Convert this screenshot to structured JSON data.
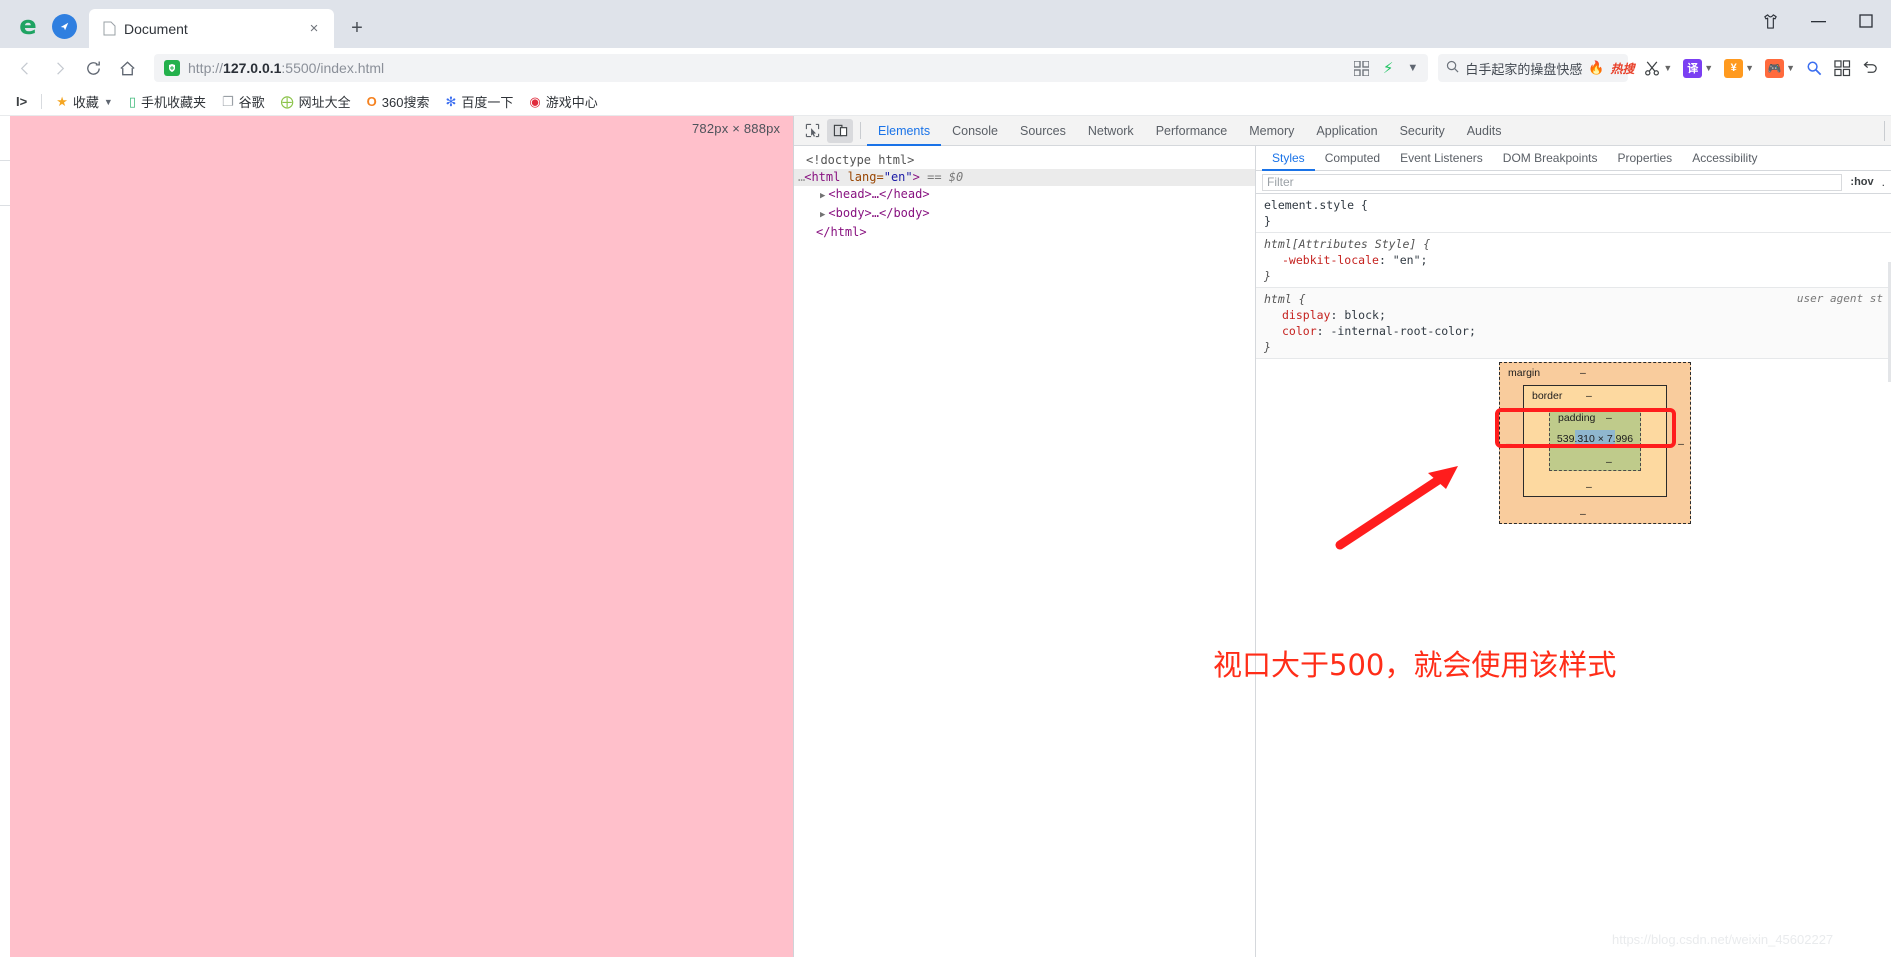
{
  "window": {
    "controls": [
      {
        "name": "theme-tshirt",
        "glyph": "👕"
      },
      {
        "name": "minimize",
        "glyph": "—"
      },
      {
        "name": "maximize",
        "glyph": "☐"
      }
    ]
  },
  "tabs": {
    "active_title": "Document",
    "close_label": "×",
    "newtab_label": "+"
  },
  "nav": {
    "back": "‹",
    "forward": "›",
    "reload": "⟳",
    "home": "⌂",
    "url_prefix": "http://",
    "url_host": "127.0.0.1",
    "url_rest": ":5500/index.html"
  },
  "search": {
    "value": "白手起家的操盘快感",
    "hot_label": "热搜"
  },
  "bookmarks": [
    {
      "label": "收藏",
      "icon": "star-icon",
      "glyph": "★",
      "color": "#f5a623",
      "caret": "▾"
    },
    {
      "label": "手机收藏夹",
      "icon": "phone-icon",
      "glyph": "▭",
      "color": "#3cb878"
    },
    {
      "label": "谷歌",
      "icon": "page-icon",
      "glyph": "❐",
      "color": "#9aa0a6"
    },
    {
      "label": "网址大全",
      "icon": "globe-plus-icon",
      "glyph": "⊕",
      "color": "#8bc34a"
    },
    {
      "label": "360搜索",
      "icon": "circle-o-icon",
      "glyph": "O",
      "color": "#f58220"
    },
    {
      "label": "百度一下",
      "icon": "paw-icon",
      "glyph": "✻",
      "color": "#3b6ef0"
    },
    {
      "label": "游戏中心",
      "icon": "g-circle-icon",
      "glyph": "G",
      "color": "#e02b3c"
    }
  ],
  "viewport": {
    "dimension_badge": "782px × 888px",
    "background": "#ffc0cb"
  },
  "devtools": {
    "panel_tabs": [
      "Elements",
      "Console",
      "Sources",
      "Network",
      "Performance",
      "Memory",
      "Application",
      "Security",
      "Audits"
    ],
    "active_panel": "Elements",
    "inspect_icon": "inspect-element-icon",
    "device_icon": "device-toolbar-icon",
    "dom": {
      "line1": "<!doctype html>",
      "line2_dots": "…",
      "line2_tag_open": "<html",
      "line2_attr": " lang=",
      "line2_attr_value": "\"en\"",
      "line2_tag_close": ">",
      "line2_selected": "== $0",
      "line3": "<head>…</head>",
      "line4": "<body>…</body>",
      "line5": "</html>"
    },
    "styles": {
      "tabs": [
        "Styles",
        "Computed",
        "Event Listeners",
        "DOM Breakpoints",
        "Properties",
        "Accessibility"
      ],
      "active_tab": "Styles",
      "filter_placeholder": "Filter",
      "hov_label": ":hov",
      "dots_label": ".cls",
      "rules": [
        {
          "selector": "element.style {",
          "close": "}",
          "declarations": [],
          "source": ""
        },
        {
          "selector": "html[Attributes Style] {",
          "close": "}",
          "declarations": [
            {
              "prop": "-webkit-locale",
              "value": "\"en\";"
            }
          ],
          "source": ""
        },
        {
          "selector": "html {",
          "close": "}",
          "declarations": [
            {
              "prop": "display",
              "value": "block;"
            },
            {
              "prop": "color",
              "value": "-internal-root-color;"
            }
          ],
          "source": "user agent st"
        }
      ]
    },
    "box_model": {
      "margin_label": "margin",
      "border_label": "border",
      "padding_label": "padding",
      "content_size": "539.310 × 7.996",
      "dash": "–"
    }
  },
  "annotation": {
    "text": "视口大于500，就会使用该样式",
    "color": "#ff2d18"
  },
  "watermark": {
    "text": "https://blog.csdn.net/weixin_45602227"
  }
}
